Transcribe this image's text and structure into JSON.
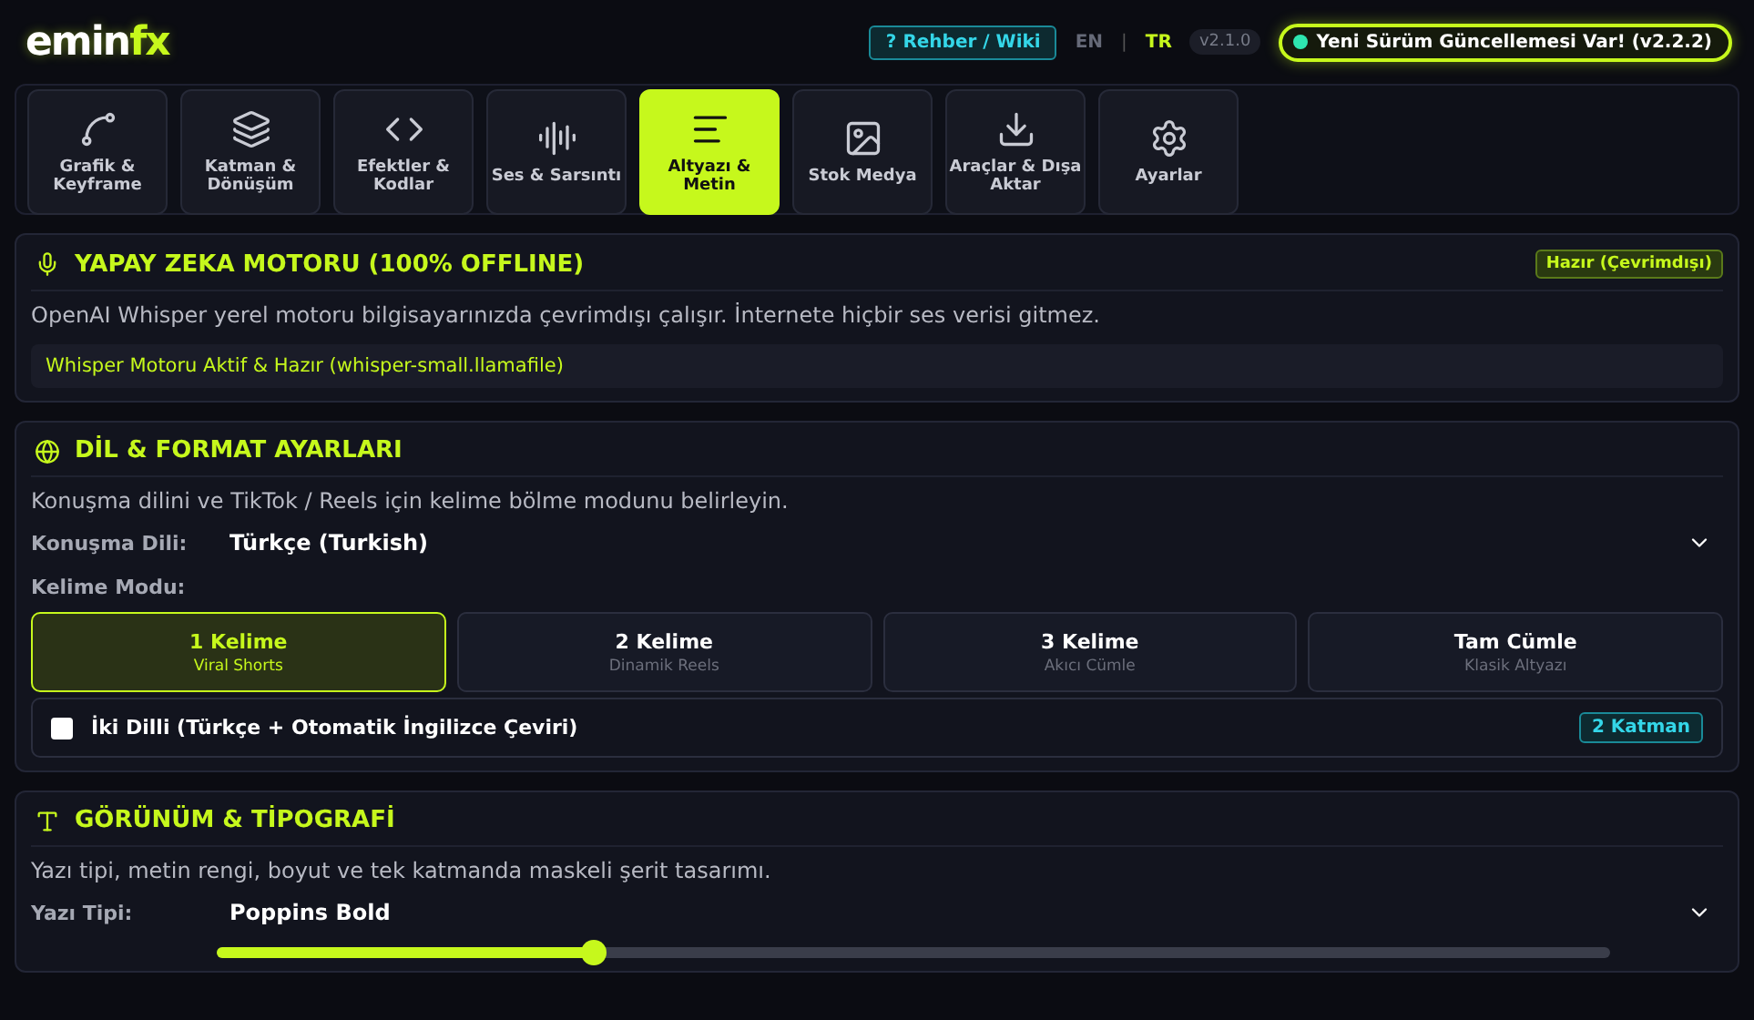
{
  "header": {
    "logo_main": "emin",
    "logo_accent": "fx",
    "help_link": "? Rehber / Wiki",
    "language_separator": "|",
    "languages": [
      {
        "label": "EN",
        "selected": false
      },
      {
        "label": "TR",
        "selected": true
      }
    ],
    "version": "v2.1.0",
    "update_badge": "Yeni Sürüm Güncellemesi Var! (v2.2.2)"
  },
  "tabs": [
    {
      "label": "Grafik & Keyframe",
      "selected": false
    },
    {
      "label": "Katman & Dönüşüm",
      "selected": false
    },
    {
      "label": "Efektler & Kodlar",
      "selected": false
    },
    {
      "label": "Ses & Sarsıntı",
      "selected": false
    },
    {
      "label": "Altyazı & Metin",
      "selected": true
    },
    {
      "label": "Stok Medya",
      "selected": false
    },
    {
      "label": "Araçlar & Dışa Aktar",
      "selected": false
    },
    {
      "label": "Ayarlar",
      "selected": false
    }
  ],
  "ai_section": {
    "title": "YAPAY ZEKA MOTORU (100% OFFLINE)",
    "status_badge": "Hazır (Çevrimdışı)",
    "description": "OpenAI Whisper yerel motoru bilgisayarınızda çevrimdışı çalışır. İnternete hiçbir ses verisi gitmez.",
    "engine_status": "Whisper Motoru Aktif & Hazır (whisper-small.llamafile)"
  },
  "language_section": {
    "title": "DİL & FORMAT AYARLARI",
    "description": "Konuşma dilini ve TikTok / Reels için kelime bölme modunu belirleyin.",
    "language_label": "Konuşma Dili:",
    "language_value": "Türkçe (Turkish)",
    "mode_label": "Kelime Modu:",
    "modes": [
      {
        "title": "1 Kelime",
        "subtitle": "Viral Shorts",
        "selected": true
      },
      {
        "title": "2 Kelime",
        "subtitle": "Dinamik Reels",
        "selected": false
      },
      {
        "title": "3 Kelime",
        "subtitle": "Akıcı Cümle",
        "selected": false
      },
      {
        "title": "Tam Cümle",
        "subtitle": "Klasik Altyazı",
        "selected": false
      }
    ],
    "bilingual": {
      "label": "İki Dilli (Türkçe + Otomatik İngilizce Çeviri)",
      "checked": false,
      "badge": "2 Katman"
    }
  },
  "typography_section": {
    "title": "GÖRÜNÜM & TİPOGRAFİ",
    "description": "Yazı tipi, metin rengi, boyut ve tek katmanda maskeli şerit tasarımı.",
    "font_label": "Yazı Tipi:",
    "font_value": "Poppins Bold",
    "size_slider": {
      "level": 0.27
    }
  }
}
